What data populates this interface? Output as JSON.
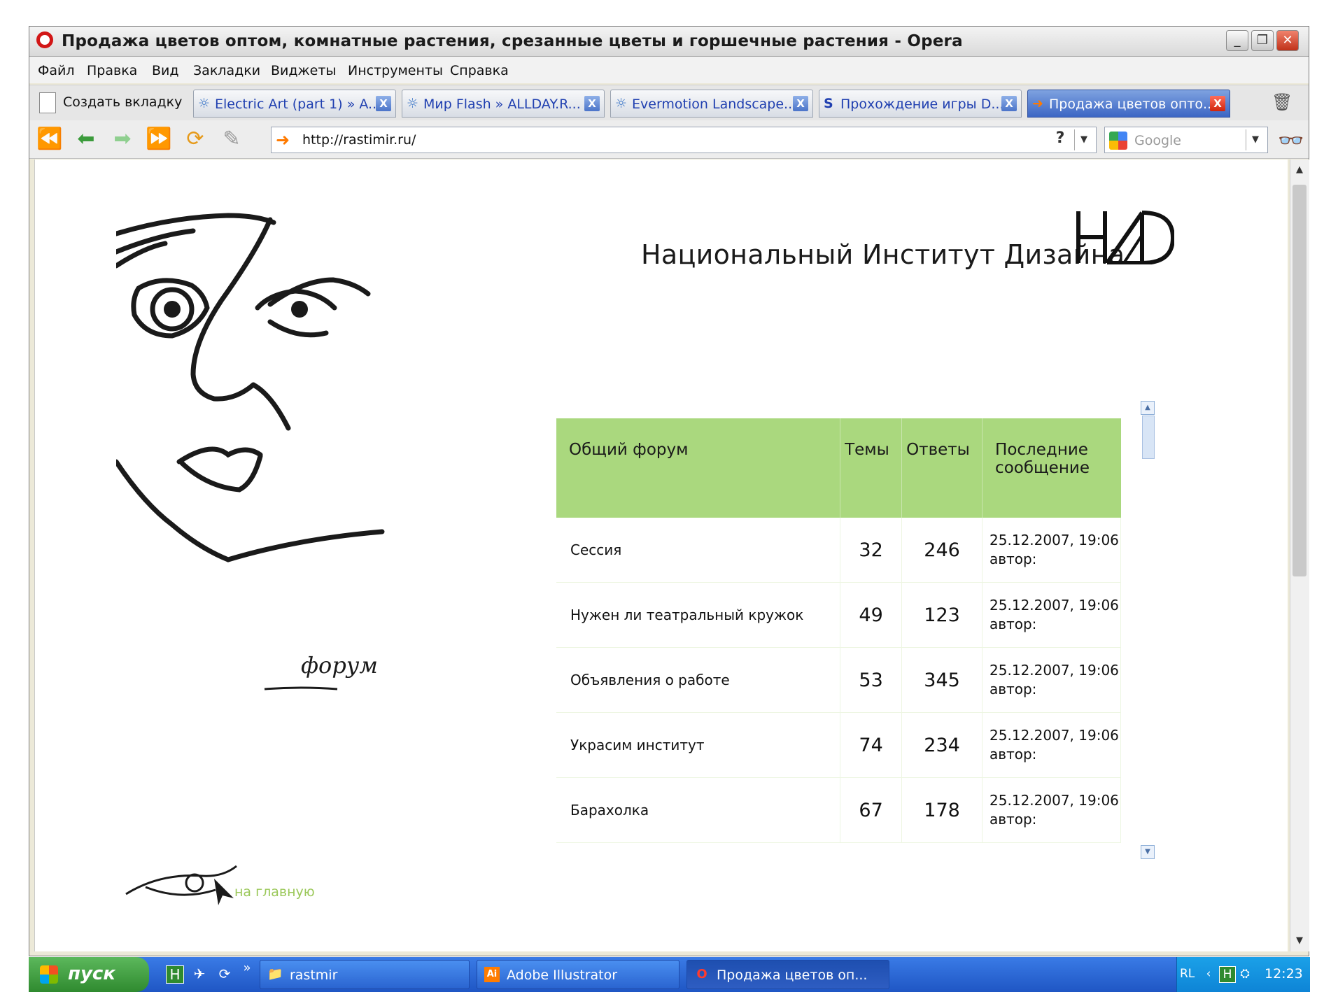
{
  "window": {
    "title": "Продажа цветов оптом, комнатные растения, срезанные цветы и горшечные растения - Opera",
    "controls": {
      "minimize": "_",
      "restore": "❐",
      "close": "✕"
    }
  },
  "menu": [
    "Файл",
    "Правка",
    "Вид",
    "Закладки",
    "Виджеты",
    "Инструменты",
    "Справка"
  ],
  "tabs": {
    "new_tab_label": "Создать вкладку",
    "items": [
      {
        "label": "Electric Art (part 1) » A...",
        "icon": "sunrise-icon",
        "active": false
      },
      {
        "label": "Мир Flash » ALLDAY.R...",
        "icon": "sunrise-icon",
        "active": false
      },
      {
        "label": "Evermotion Landscape...",
        "icon": "sunrise-icon",
        "active": false
      },
      {
        "label": "Прохождение игры D...",
        "icon": "s-icon",
        "active": false
      },
      {
        "label": "Продажа цветов опто...",
        "icon": "arrow-icon",
        "active": true
      }
    ],
    "close_glyph": "X"
  },
  "address": {
    "url": "http://rastimir.ru/",
    "help": "?",
    "search_placeholder": "Google"
  },
  "page": {
    "site_title": "Национальный Институт Дизайна",
    "signature": "форум",
    "home_link": "на главную",
    "forum": {
      "headers": {
        "forum": "Общий форум",
        "topics": "Темы",
        "replies": "Ответы",
        "last": "Последние сообщение"
      },
      "rows": [
        {
          "name": "Сессия",
          "topics": "32",
          "replies": "246",
          "date": "25.12.2007, 19:06",
          "author": "автор:"
        },
        {
          "name": "Нужен ли театральный кружок",
          "topics": "49",
          "replies": "123",
          "date": "25.12.2007, 19:06",
          "author": "автор:"
        },
        {
          "name": "Объявления о работе",
          "topics": "53",
          "replies": "345",
          "date": "25.12.2007, 19:06",
          "author": "автор:"
        },
        {
          "name": "Украсим институт",
          "topics": "74",
          "replies": "234",
          "date": "25.12.2007, 19:06",
          "author": "автор:"
        },
        {
          "name": "Барахолка",
          "topics": "67",
          "replies": "178",
          "date": "25.12.2007, 19:06",
          "author": "автор:"
        }
      ]
    }
  },
  "taskbar": {
    "start_label": "пуск",
    "tasks": [
      {
        "label": "rastmir",
        "icon": "folder-icon"
      },
      {
        "label": "Adobe Illustrator",
        "icon": "illustrator-icon"
      },
      {
        "label": "Продажа цветов оп...",
        "icon": "opera-icon"
      }
    ],
    "tray": {
      "lang": "RL",
      "time": "12:23"
    },
    "more": "»"
  },
  "colors": {
    "table_header": "#aad87e",
    "home_link": "#9bc85a",
    "taskbar": "#245edb",
    "start": "#3c9b3c"
  }
}
